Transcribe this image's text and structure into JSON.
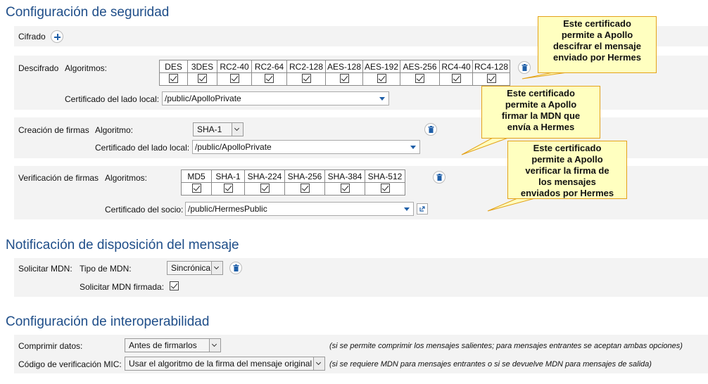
{
  "security": {
    "title": "Configuración de seguridad",
    "cifrado_label": "Cifrado",
    "descifrado": {
      "label": "Descifrado",
      "alg_label": "Algoritmos:",
      "algorithms": [
        "DES",
        "3DES",
        "RC2-40",
        "RC2-64",
        "RC2-128",
        "AES-128",
        "AES-192",
        "AES-256",
        "RC4-40",
        "RC4-128"
      ],
      "cert_label": "Certificado del lado local:",
      "cert_value": "/public/ApolloPrivate"
    },
    "firmas": {
      "label": "Creación de firmas",
      "alg_label": "Algoritmo:",
      "alg_value": "SHA-1",
      "cert_label": "Certificado del lado local:",
      "cert_value": "/public/ApolloPrivate"
    },
    "verificacion": {
      "label": "Verificación de firmas",
      "alg_label": "Algoritmos:",
      "algorithms": [
        "MD5",
        "SHA-1",
        "SHA-224",
        "SHA-256",
        "SHA-384",
        "SHA-512"
      ],
      "cert_label": "Certificado del socio:",
      "cert_value": "/public/HermesPublic"
    }
  },
  "mdn": {
    "title": "Notificación de disposición del mensaje",
    "solicitar_label": "Solicitar MDN:",
    "tipo_label": "Tipo de MDN:",
    "tipo_value": "Sincrónica",
    "firmada_label": "Solicitar MDN firmada:"
  },
  "interop": {
    "title": "Configuración de interoperabilidad",
    "comprimir_label": "Comprimir datos:",
    "comprimir_value": "Antes de firmarlos",
    "comprimir_note": "(si se permite comprimir los mensajes salientes; para mensajes entrantes se aceptan ambas opciones)",
    "mic_label": "Código de verificación MIC:",
    "mic_value": "Usar el algoritmo de la firma del mensaje original",
    "mic_note": "(si se requiere MDN para mensajes entrantes o si se devuelve MDN para mensajes de salida)"
  },
  "callouts": [
    {
      "lines": [
        "Este certificado",
        "permite a Apollo",
        "descifrar el mensaje",
        "enviado por Hermes"
      ]
    },
    {
      "lines": [
        "Este certificado",
        "permite a Apollo",
        "firmar la MDN que",
        "envía a Hermes"
      ]
    },
    {
      "lines": [
        "Este certificado",
        "permite a Apollo",
        "verificar la firma de",
        "los mensajes",
        "enviados por Hermes"
      ]
    }
  ],
  "colors": {
    "heading": "#1f4e89",
    "accent": "#1f5fa8",
    "callout_bg": "#ffffc0",
    "callout_border": "#e3a21a",
    "panel_bg": "#f3f3f3"
  }
}
